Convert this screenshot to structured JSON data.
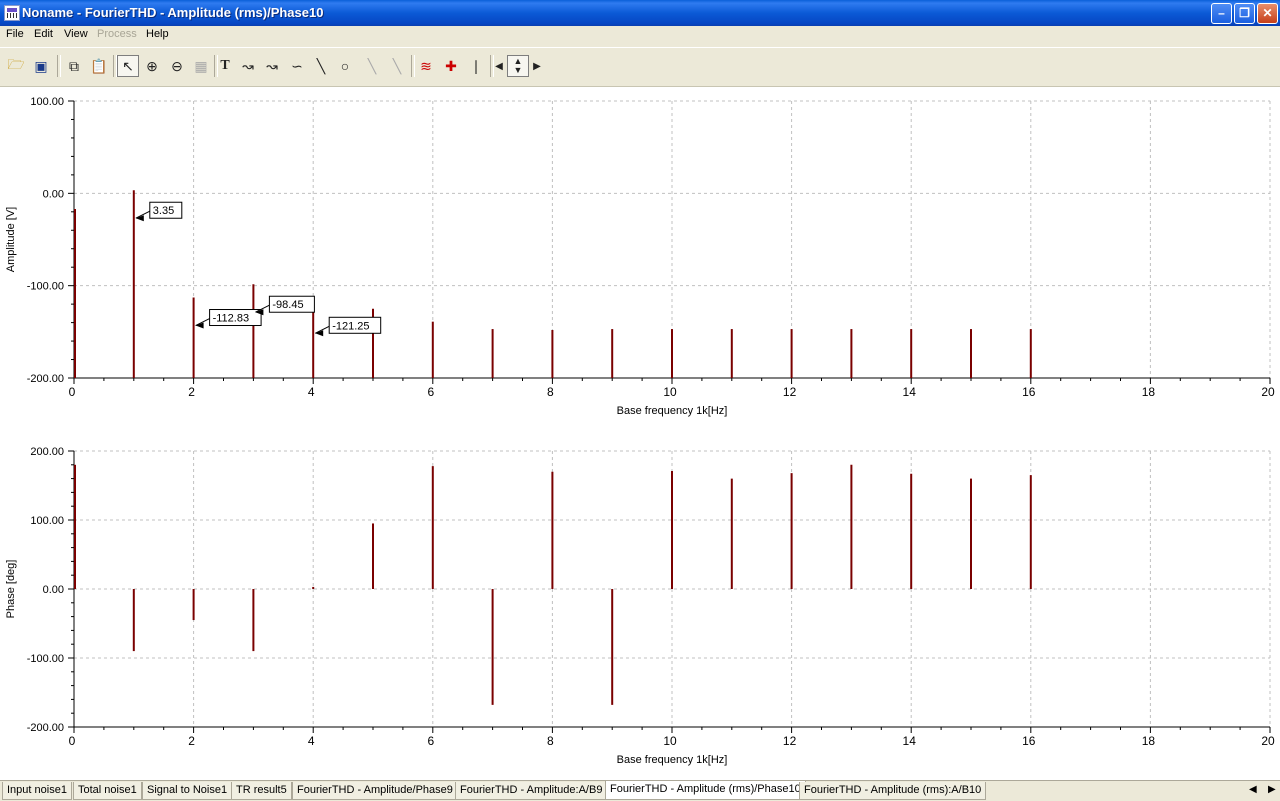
{
  "window": {
    "title": "Noname - FourierTHD - Amplitude (rms)/Phase10"
  },
  "menu": [
    {
      "label": "File",
      "enabled": true
    },
    {
      "label": "Edit",
      "enabled": true
    },
    {
      "label": "View",
      "enabled": true
    },
    {
      "label": "Process",
      "enabled": false
    },
    {
      "label": "Help",
      "enabled": true
    }
  ],
  "toolbar_icons": [
    "open-folder-icon",
    "save-icon",
    "copy-icon",
    "paste-icon",
    "pointer-icon",
    "zoom-in-icon",
    "zoom-out-icon",
    "grid-icon",
    "text-icon",
    "cursor-a-icon",
    "cursor-b-icon",
    "function-icon",
    "line-icon",
    "circle-icon",
    "diagonal-a-icon",
    "diagonal-b-icon",
    "add-trace-icon",
    "probe-icon",
    "marker-icon",
    "arrow-left-icon",
    "arrow-updown-icon",
    "arrow-right-icon"
  ],
  "colors": {
    "bar": "#7a0000",
    "grid": "#c0c0c0",
    "titlebar": "#0b5ad6"
  },
  "chart_data": [
    {
      "type": "bar",
      "xlabel": "Base frequency 1k[Hz]",
      "ylabel": "Amplitude [V]",
      "xlim": [
        0,
        20
      ],
      "ylim": [
        -200,
        100
      ],
      "x_ticks": [
        0,
        2,
        4,
        6,
        8,
        10,
        12,
        14,
        16,
        18,
        20
      ],
      "y_ticks": [
        "100.00",
        "0.00",
        "-100.00",
        "-200.00"
      ],
      "grid": true,
      "x": [
        0,
        1,
        2,
        3,
        4,
        5,
        6,
        7,
        8,
        9,
        10,
        11,
        12,
        13,
        14,
        15,
        16
      ],
      "values": [
        -17,
        3.35,
        -112.83,
        -98.45,
        -121.25,
        -125,
        -139,
        -147,
        -148,
        -147,
        -147,
        -147,
        -147,
        -147,
        -147,
        -147,
        -147
      ],
      "annotations": [
        {
          "x": 1,
          "y": 3.35,
          "text": "3.35"
        },
        {
          "x": 2,
          "y": -112.83,
          "text": "-112.83"
        },
        {
          "x": 3,
          "y": -98.45,
          "text": "-98.45"
        },
        {
          "x": 4,
          "y": -121.25,
          "text": "-121.25"
        }
      ]
    },
    {
      "type": "bar",
      "xlabel": "Base frequency 1k[Hz]",
      "ylabel": "Phase [deg]",
      "xlim": [
        0,
        20
      ],
      "ylim": [
        -200,
        200
      ],
      "x_ticks": [
        0,
        2,
        4,
        6,
        8,
        10,
        12,
        14,
        16,
        18,
        20
      ],
      "y_ticks": [
        "200.00",
        "100.00",
        "0.00",
        "-100.00",
        "-200.00"
      ],
      "grid": true,
      "x": [
        0,
        1,
        2,
        3,
        4,
        5,
        6,
        7,
        8,
        9,
        10,
        11,
        12,
        13,
        14,
        15,
        16
      ],
      "values": [
        180,
        -90,
        -45,
        -90,
        3,
        95,
        178,
        -168,
        170,
        -168,
        171,
        160,
        168,
        180,
        167,
        160,
        165
      ],
      "annotations": []
    }
  ],
  "tabs": [
    {
      "label": "Input noise1",
      "active": false
    },
    {
      "label": "Total noise1",
      "active": false
    },
    {
      "label": "Signal to Noise1",
      "active": false
    },
    {
      "label": "TR result5",
      "active": false
    },
    {
      "label": "FourierTHD - Amplitude/Phase9",
      "active": false
    },
    {
      "label": "FourierTHD - Amplitude:A/B9",
      "active": false
    },
    {
      "label": "FourierTHD - Amplitude (rms)/Phase10",
      "active": true
    },
    {
      "label": "FourierTHD - Amplitude (rms):A/B10",
      "active": false
    }
  ]
}
